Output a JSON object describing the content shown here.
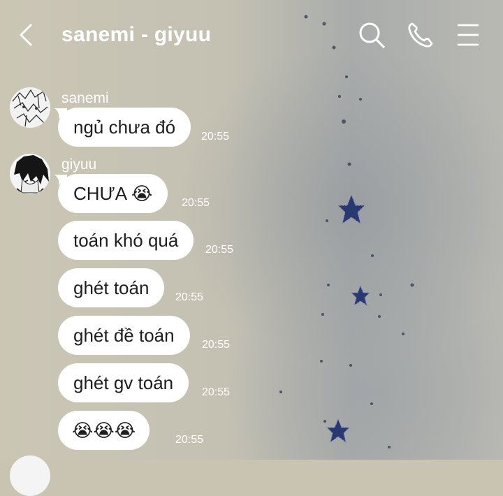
{
  "header": {
    "title": "sanemi - giyuu",
    "back_icon": "chevron-left-icon",
    "search_icon": "search-icon",
    "call_icon": "phone-icon",
    "menu_icon": "menu-icon"
  },
  "messages": [
    {
      "sender": "sanemi",
      "text": "ngủ chưa đó",
      "time": "20:55"
    },
    {
      "sender": "giyuu",
      "text": "CHƯA 😭",
      "time": "20:55"
    },
    {
      "sender": "giyuu",
      "text": "toán khó quá",
      "time": "20:55"
    },
    {
      "sender": "giyuu",
      "text": "ghét toán",
      "time": "20:55"
    },
    {
      "sender": "giyuu",
      "text": "ghét đề toán",
      "time": "20:55"
    },
    {
      "sender": "giyuu",
      "text": "ghét gv toán",
      "time": "20:55"
    },
    {
      "sender": "giyuu",
      "text": "😭😭😭",
      "time": "20:55"
    }
  ],
  "colors": {
    "bubble": "#ffffff",
    "text": "#1e1e1e",
    "header_text": "#ffffff",
    "background": "#c9c3b2",
    "star": "#2a3870"
  }
}
